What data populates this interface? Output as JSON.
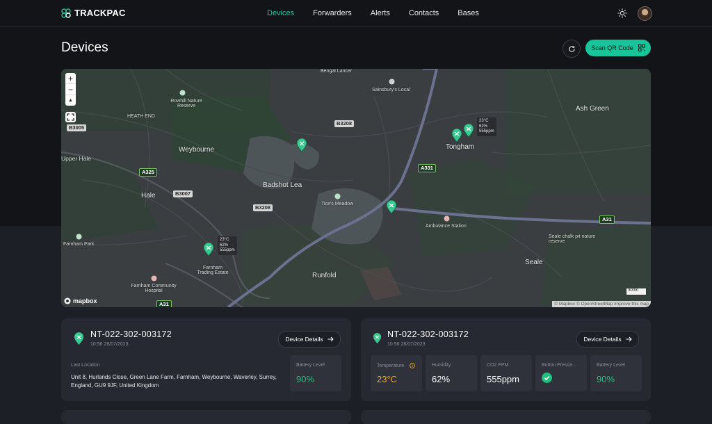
{
  "nav": {
    "brand": "TRACKPAC",
    "links": [
      {
        "label": "Devices",
        "active": true
      },
      {
        "label": "Forwarders",
        "active": false
      },
      {
        "label": "Alerts",
        "active": false
      },
      {
        "label": "Contacts",
        "active": false
      },
      {
        "label": "Bases",
        "active": false
      }
    ]
  },
  "page": {
    "title": "Devices",
    "scan_label": "Scan QR Code"
  },
  "colors": {
    "accent": "#18c49a",
    "active_nav": "#2ec4a0",
    "battery": "#22c07e",
    "temperature": "#f2a81d"
  },
  "map": {
    "zoom_in": "+",
    "zoom_out": "−",
    "north": "▲",
    "labels": {
      "bengal_lancer": "Bengal Lancer",
      "sainsburys": "Sainsbury's Local",
      "rowhill": "Rowhill Nature Reserve",
      "heath_end": "HEATH END",
      "ash_green": "Ash Green",
      "weybourne": "Weybourne",
      "upper_hale": "Upper Hale",
      "tongham": "Tongham",
      "badshot_lea": "Badshot Lea",
      "hale": "Hale",
      "tices_meadow": "Tice's Meadow",
      "ambulance": "Ambulance Station",
      "seale_chalk": "Seale chalk pit nature reserve",
      "farnham_park": "Farnham Park",
      "farnham_trading": "Farnham Trading Estate",
      "seale": "Seale",
      "runfold": "Runfold",
      "farnham_community": "Farnham Community Hospital"
    },
    "roads": {
      "b3005": "B3005",
      "b3208a": "B3208",
      "b3208b": "B3208",
      "a325": "A325",
      "b3007": "B3007",
      "a331": "A331",
      "a31a": "A31",
      "a31b": "A31"
    },
    "popup1": {
      "temp": "23°C",
      "humidity": "62%",
      "co2": "555ppm"
    },
    "popup2": {
      "temp": "23°C",
      "humidity": "62%",
      "co2": "555ppm"
    },
    "logo": "mapbox",
    "attribution": "© Mapbox © OpenStreetMap Improve this map",
    "scale": "300m"
  },
  "cards": [
    {
      "device_id": "NT-022-302-003172",
      "timestamp": "10:56 28/07/2023",
      "details_label": "Device Details",
      "last_location_caption": "Last Location",
      "last_location": "Unit 8, Hurlands Close, Green Lane Farm, Farnham, Weybourne, Waverley, Surrey, England, GU9 9JF, United Kingdom",
      "battery_caption": "Battery Level",
      "battery": "90%"
    },
    {
      "device_id": "NT-022-302-003172",
      "timestamp": "10:56 28/07/2023",
      "details_label": "Device Details",
      "tiles": [
        {
          "caption": "Temperature",
          "value": "23°C"
        },
        {
          "caption": "Humidity",
          "value": "62%"
        },
        {
          "caption": "CO2 PPM",
          "value": "555ppm"
        },
        {
          "caption": "Button Presse..."
        },
        {
          "caption": "Battery Level",
          "value": "90%"
        }
      ]
    }
  ]
}
